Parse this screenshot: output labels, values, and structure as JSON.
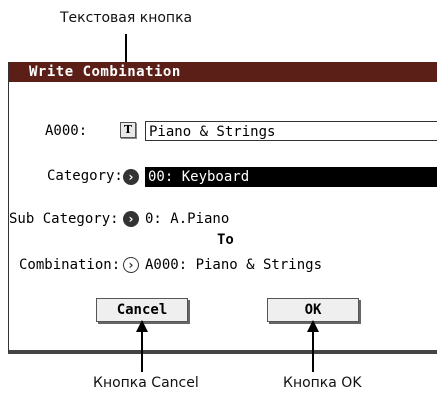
{
  "callouts": {
    "text_button": "Текстовая кнопка",
    "cancel_button": "Кнопка Cancel",
    "ok_button": "Кнопка OK"
  },
  "dialog": {
    "title": "Write Combination",
    "name_label": "A000:",
    "name_value": "Piano & Strings",
    "category_label": "Category:",
    "category_value": "00: Keyboard",
    "subcategory_label": "Sub Category:",
    "subcategory_value": "0: A.Piano",
    "to_label": "To",
    "combination_label": "Combination:",
    "combination_value": "A000: Piano & Strings",
    "cancel_label": "Cancel",
    "ok_label": "OK"
  },
  "icons": {
    "text_edit": "T",
    "dropdown_arrow": "›"
  },
  "colors": {
    "titlebar": "#5b1f17",
    "selected_field": "#000000"
  }
}
